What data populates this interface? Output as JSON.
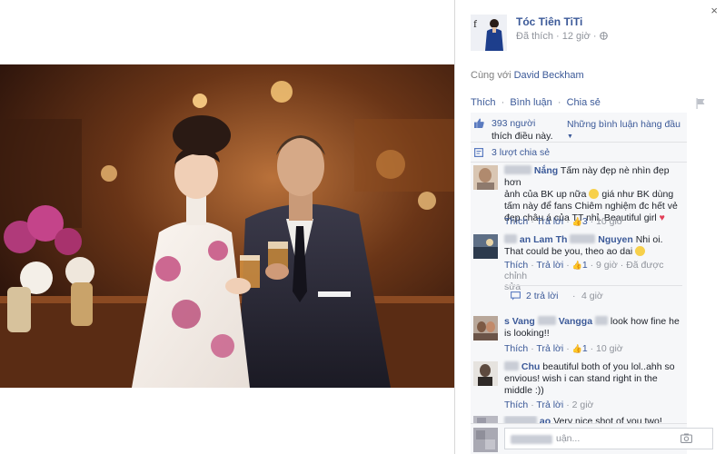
{
  "post": {
    "author": "Tóc Tiên TiTi",
    "liked_label": "Đã thích",
    "time": "12 giờ",
    "with_prefix": "Cùng với",
    "with_name": "David Beckham",
    "actions": [
      "Thích",
      "Bình luận",
      "Chia sẻ"
    ]
  },
  "ufi": {
    "likes_count": "393 người",
    "likes_suffix": "thích điều này.",
    "sort_label": "Những bình luận hàng đầu",
    "shares": "3 lượt chia sẻ"
  },
  "comments": [
    {
      "name": "Nắng",
      "text_1": "Tấm này đẹp nè nhìn đẹp hơn",
      "text_2": "ảnh của BK up nữa",
      "text_3": "giá như BK dùng",
      "text_4": "tấm này để fans Chiêm nghiệm đc hết vẻ",
      "text_5": "đẹp châu á của TT nhỉ. Beautiful girl",
      "like": "Thích",
      "reply": "Trả lời",
      "count": "3",
      "time": "10 giờ"
    },
    {
      "name_a": "an Lam",
      "name_b": "Th",
      "name_c": "Nguyen",
      "text_1": "Nhi oi.",
      "text_2": "That could be you, theo ao dai",
      "like": "Thích",
      "reply": "Trả lời",
      "count": "1",
      "time": "9 giờ",
      "edited": "Đã được chỉnh",
      "edited_2": "sửa",
      "replies": "2 trả lời",
      "replies_time": "4 giờ"
    },
    {
      "name_a": "s Vang",
      "name_b": "Vangga",
      "text_1": "look how fine he",
      "text_2": "is looking!!",
      "like": "Thích",
      "reply": "Trả lời",
      "count": "1",
      "time": "10 giờ"
    },
    {
      "name": "Chu",
      "text_1": "beautiful both of you lol..ahh so",
      "text_2": "envious! wish i can stand right in the",
      "text_3": "middle :))",
      "like": "Thích",
      "reply": "Trả lời",
      "time": "2 giờ"
    },
    {
      "name": "ao",
      "text_1": "Very nice shot of you two!"
    }
  ],
  "write_placeholder": "uận...",
  "close": "×",
  "colors": {
    "link": "#3b5998",
    "muted": "#90949c",
    "panel_bg": "#f6f7f9"
  },
  "icons": [
    "close-icon",
    "globe-icon",
    "flag-icon",
    "like-thumb-icon",
    "share-icon",
    "reply-icon",
    "camera-icon"
  ]
}
